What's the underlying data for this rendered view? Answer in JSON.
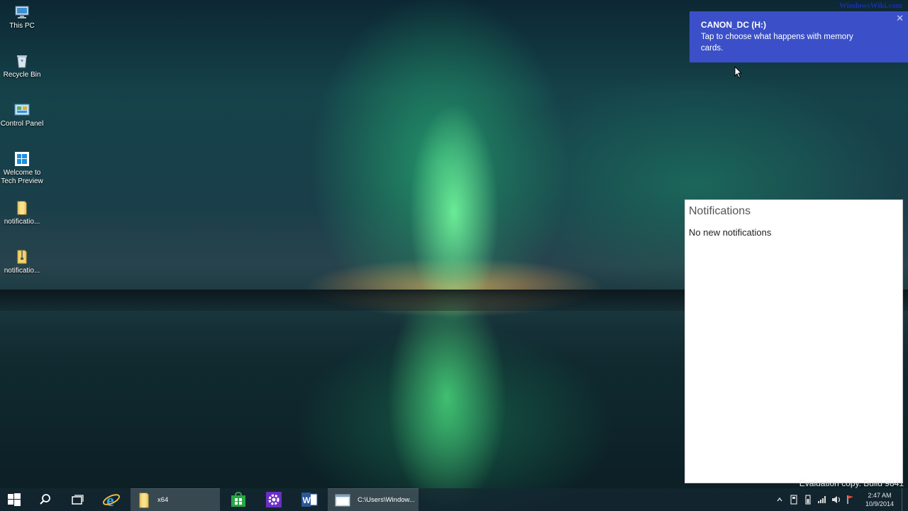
{
  "desktop": {
    "icons": [
      {
        "label": "This PC",
        "icon": "computer-icon"
      },
      {
        "label": "Recycle Bin",
        "icon": "recycle-bin-icon"
      },
      {
        "label": "Control Panel",
        "icon": "control-panel-icon"
      },
      {
        "label": "Welcome to Tech Preview",
        "icon": "windows-welcome-icon"
      },
      {
        "label": "notificatio...",
        "icon": "folder-icon"
      },
      {
        "label": "notificatio...",
        "icon": "folder-zip-icon"
      }
    ],
    "watermark": "WindowsWiki.com"
  },
  "toast": {
    "title": "CANON_DC (H:)",
    "body": "Tap to choose what happens with memory cards.",
    "close": "✕",
    "color": "#3b50c8"
  },
  "notifications": {
    "title": "Notifications",
    "empty_text": "No new notifications"
  },
  "evaluation_text": "Evaluation copy. Build 9841",
  "taskbar": {
    "items": [
      {
        "name": "start",
        "icon": "windows-logo-icon"
      },
      {
        "name": "search",
        "icon": "search-icon"
      },
      {
        "name": "task-view",
        "icon": "task-view-icon"
      },
      {
        "name": "internet-explorer",
        "icon": "internet-explorer-icon"
      },
      {
        "name": "file-explorer",
        "icon": "folder-icon",
        "label": "x64"
      },
      {
        "name": "store",
        "icon": "store-icon"
      },
      {
        "name": "settings",
        "icon": "settings-icon"
      },
      {
        "name": "word",
        "icon": "word-icon"
      },
      {
        "name": "command-prompt",
        "icon": "window-icon",
        "label": "C:\\Users\\Window..."
      }
    ],
    "tray": {
      "icons": [
        "chevron-up-icon",
        "action-center-icon",
        "power-icon",
        "network-icon",
        "volume-icon",
        "notification-flag-icon"
      ],
      "time": "2:47 AM",
      "date": "10/9/2014"
    }
  }
}
